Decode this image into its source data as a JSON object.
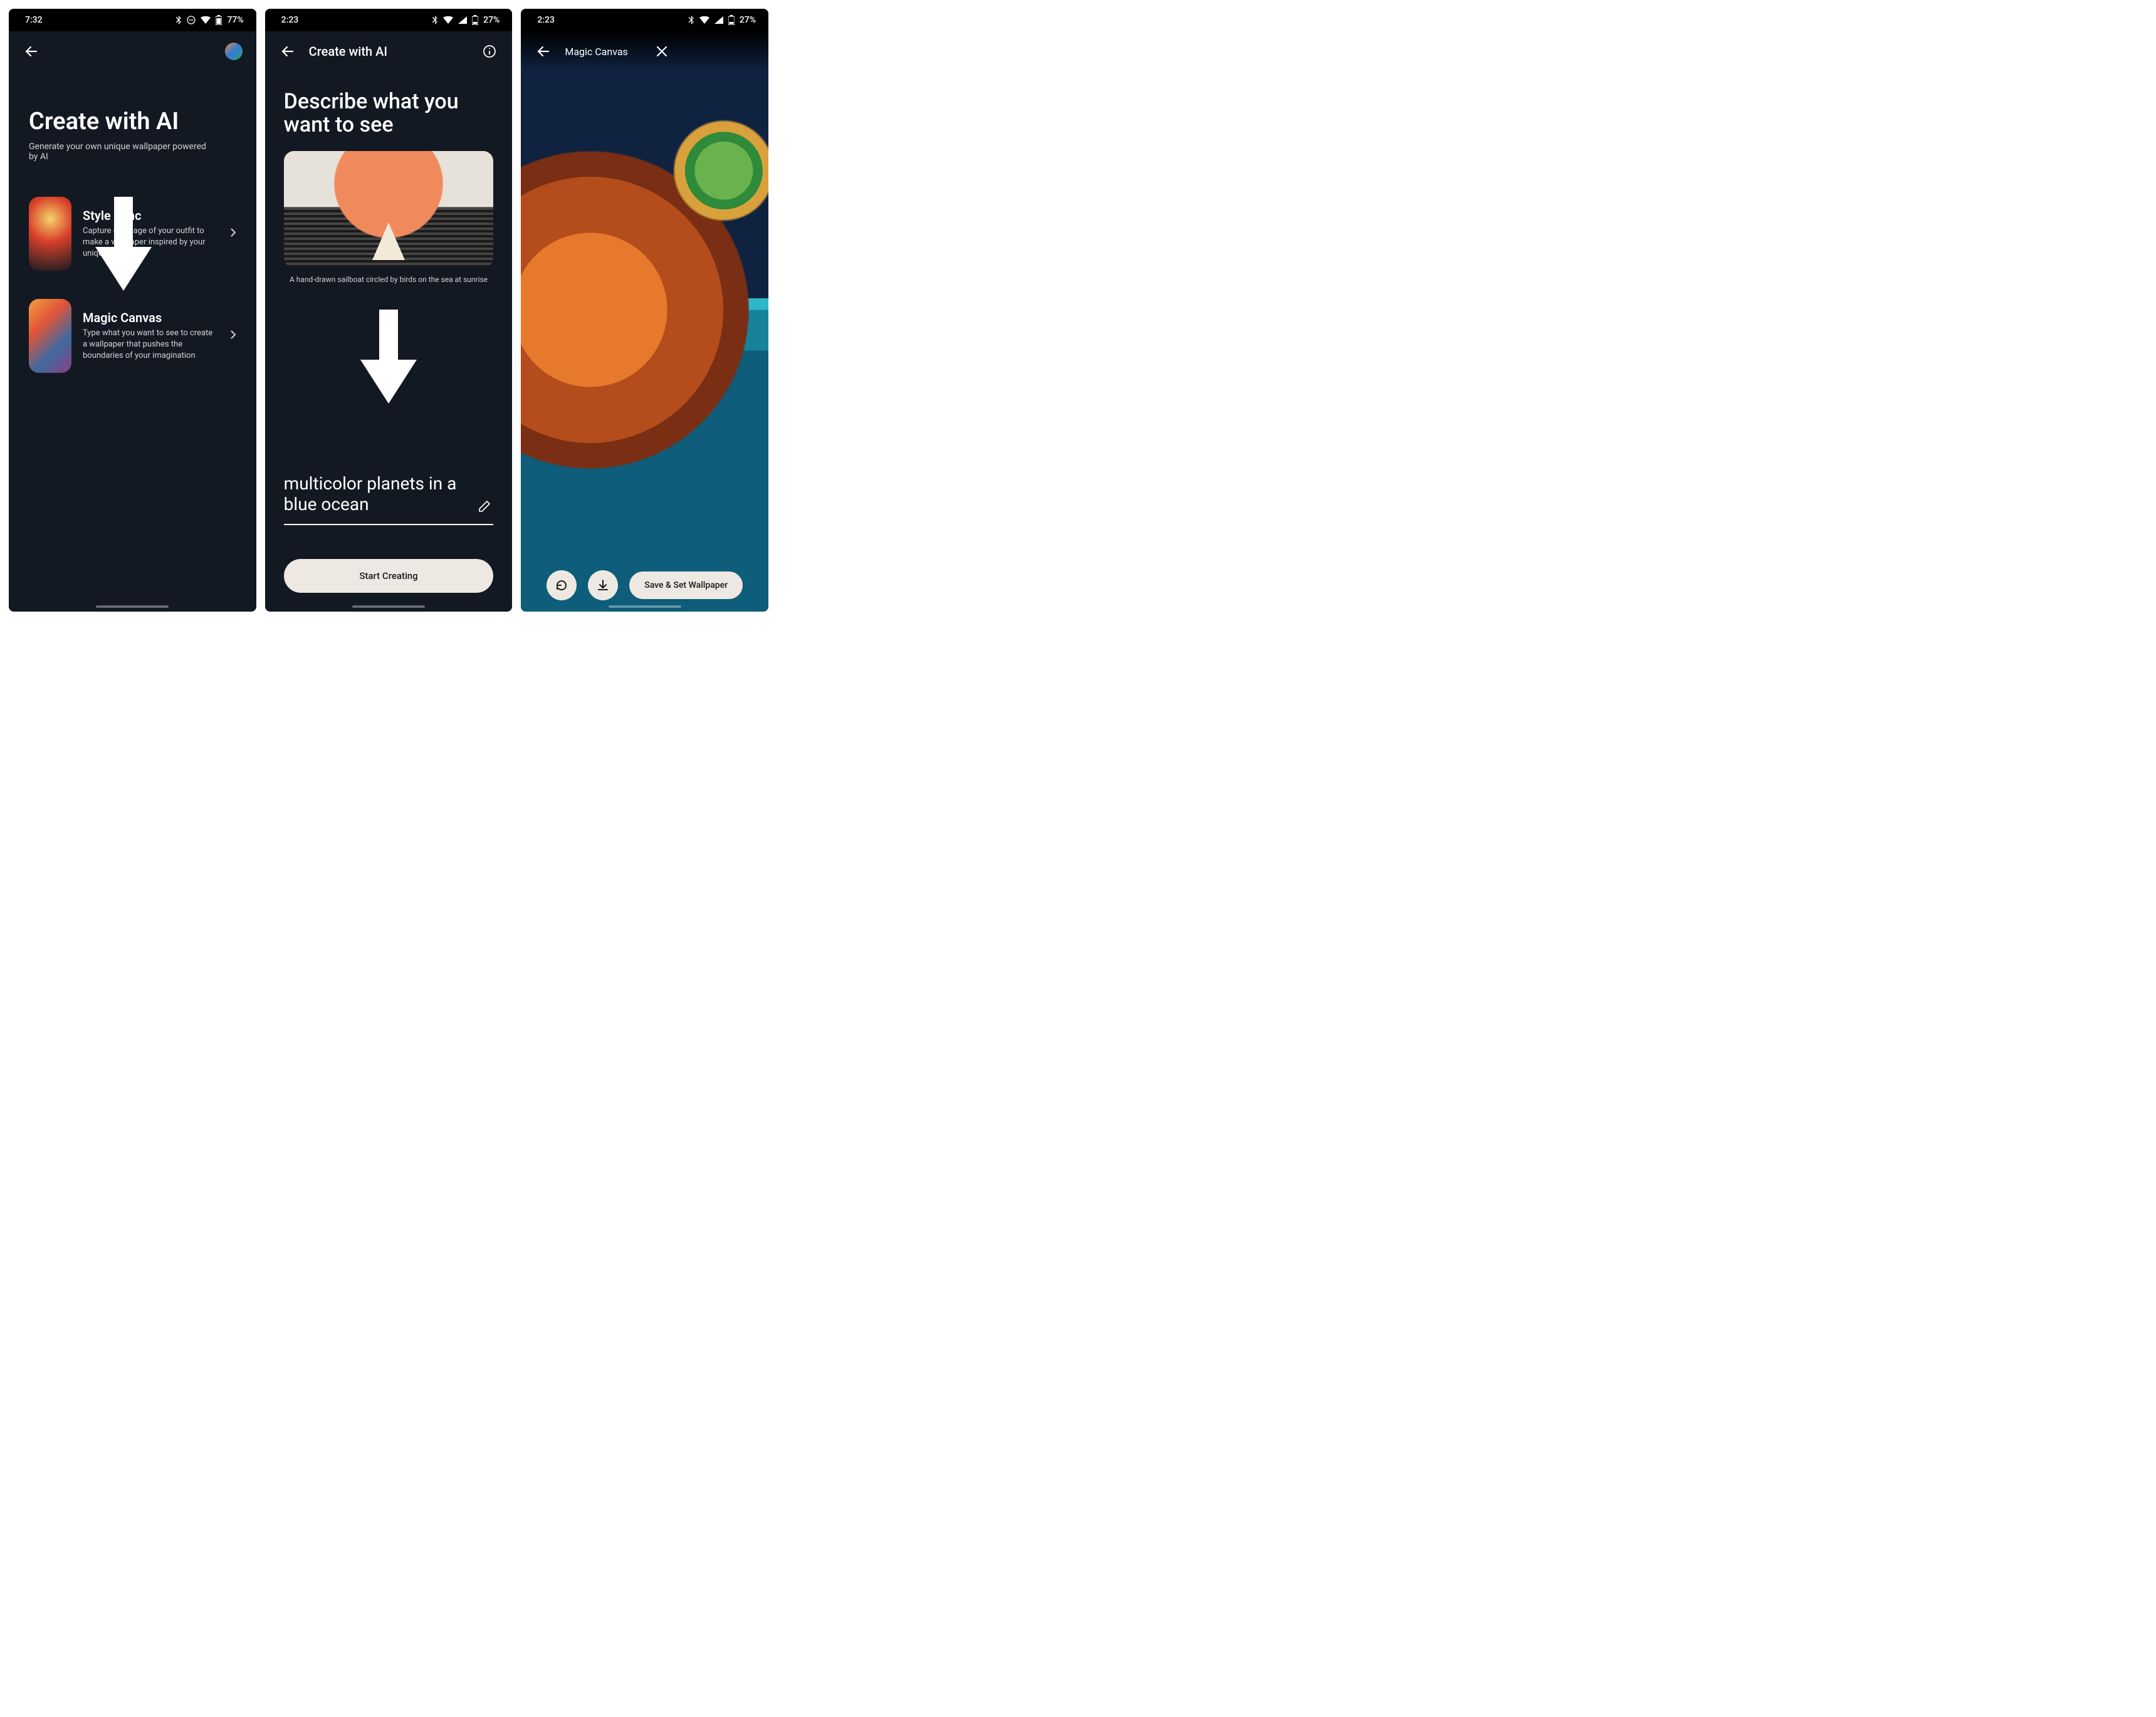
{
  "screen1": {
    "status": {
      "time": "7:32",
      "battery": "77%"
    },
    "page_title": "Create with AI",
    "page_subtitle": "Generate your own unique wallpaper powered by AI",
    "options": [
      {
        "title": "Style Sync",
        "desc": "Capture an image of your outfit to make a wallpaper inspired by your unique style"
      },
      {
        "title": "Magic Canvas",
        "desc": "Type what you want to see to create a wallpaper that pushes the boundaries of your imagination"
      }
    ]
  },
  "screen2": {
    "status": {
      "time": "2:23",
      "battery": "27%"
    },
    "header_title": "Create with AI",
    "describe_title": "Describe what you want to see",
    "example_caption": "A hand-drawn sailboat circled by birds on the sea at sunrise",
    "prompt_value": "multicolor planets in a blue ocean",
    "start_button": "Start Creating"
  },
  "screen3": {
    "status": {
      "time": "2:23",
      "battery": "27%"
    },
    "header_title": "Magic Canvas",
    "save_button": "Save & Set Wallpaper"
  }
}
